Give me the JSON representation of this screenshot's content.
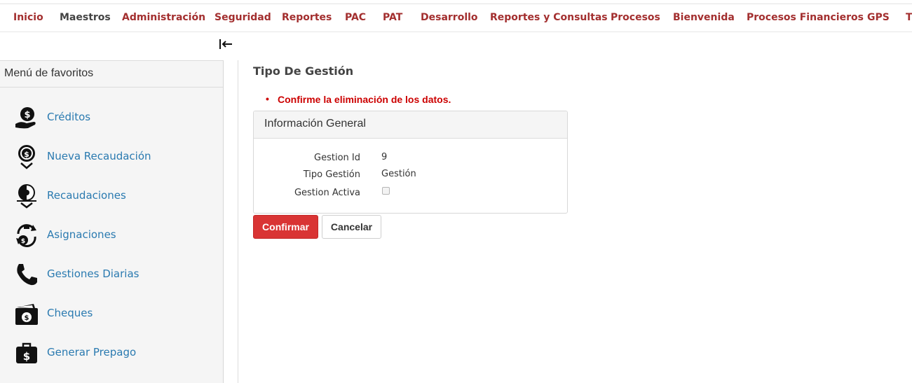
{
  "nav": {
    "items": [
      {
        "label": "Inicio"
      },
      {
        "label": "Maestros"
      },
      {
        "label": "Administración"
      },
      {
        "label": "Seguridad"
      },
      {
        "label": "Reportes"
      },
      {
        "label": "PAC"
      },
      {
        "label": "PAT"
      },
      {
        "label": "Desarrollo"
      },
      {
        "label": "Reportes y Consultas"
      },
      {
        "label": "Procesos"
      },
      {
        "label": "Bienvenida"
      },
      {
        "label": "Procesos Financieros"
      },
      {
        "label": "GPS"
      },
      {
        "label": "T"
      }
    ]
  },
  "sidebar": {
    "title": "Menú de favoritos",
    "items": [
      {
        "label": "Créditos",
        "icon": "money-hand-icon"
      },
      {
        "label": "Nueva Recaudación",
        "icon": "money-download-icon"
      },
      {
        "label": "Recaudaciones",
        "icon": "collection-download-icon"
      },
      {
        "label": "Asignaciones",
        "icon": "money-cycle-icon"
      },
      {
        "label": "Gestiones Diarias",
        "icon": "phone-icon"
      },
      {
        "label": "Cheques",
        "icon": "wallet-icon"
      },
      {
        "label": "Generar Prepago",
        "icon": "briefcase-dollar-icon"
      }
    ]
  },
  "page": {
    "title": "Tipo De Gestión",
    "validation_message": "Confirme la eliminación de los datos."
  },
  "panel": {
    "heading": "Información General",
    "fields": {
      "gestion_id": {
        "label": "Gestion Id",
        "value": "9"
      },
      "tipo_gestion": {
        "label": "Tipo Gestión",
        "value": "Gestión"
      },
      "gestion_activa": {
        "label": "Gestion Activa",
        "checked": false
      }
    }
  },
  "buttons": {
    "confirm": "Confirmar",
    "cancel": "Cancelar"
  },
  "colors": {
    "nav_text": "#a32f2f",
    "link_blue": "#2a7ab0",
    "danger": "#d93434",
    "error_text": "#cc0000"
  }
}
